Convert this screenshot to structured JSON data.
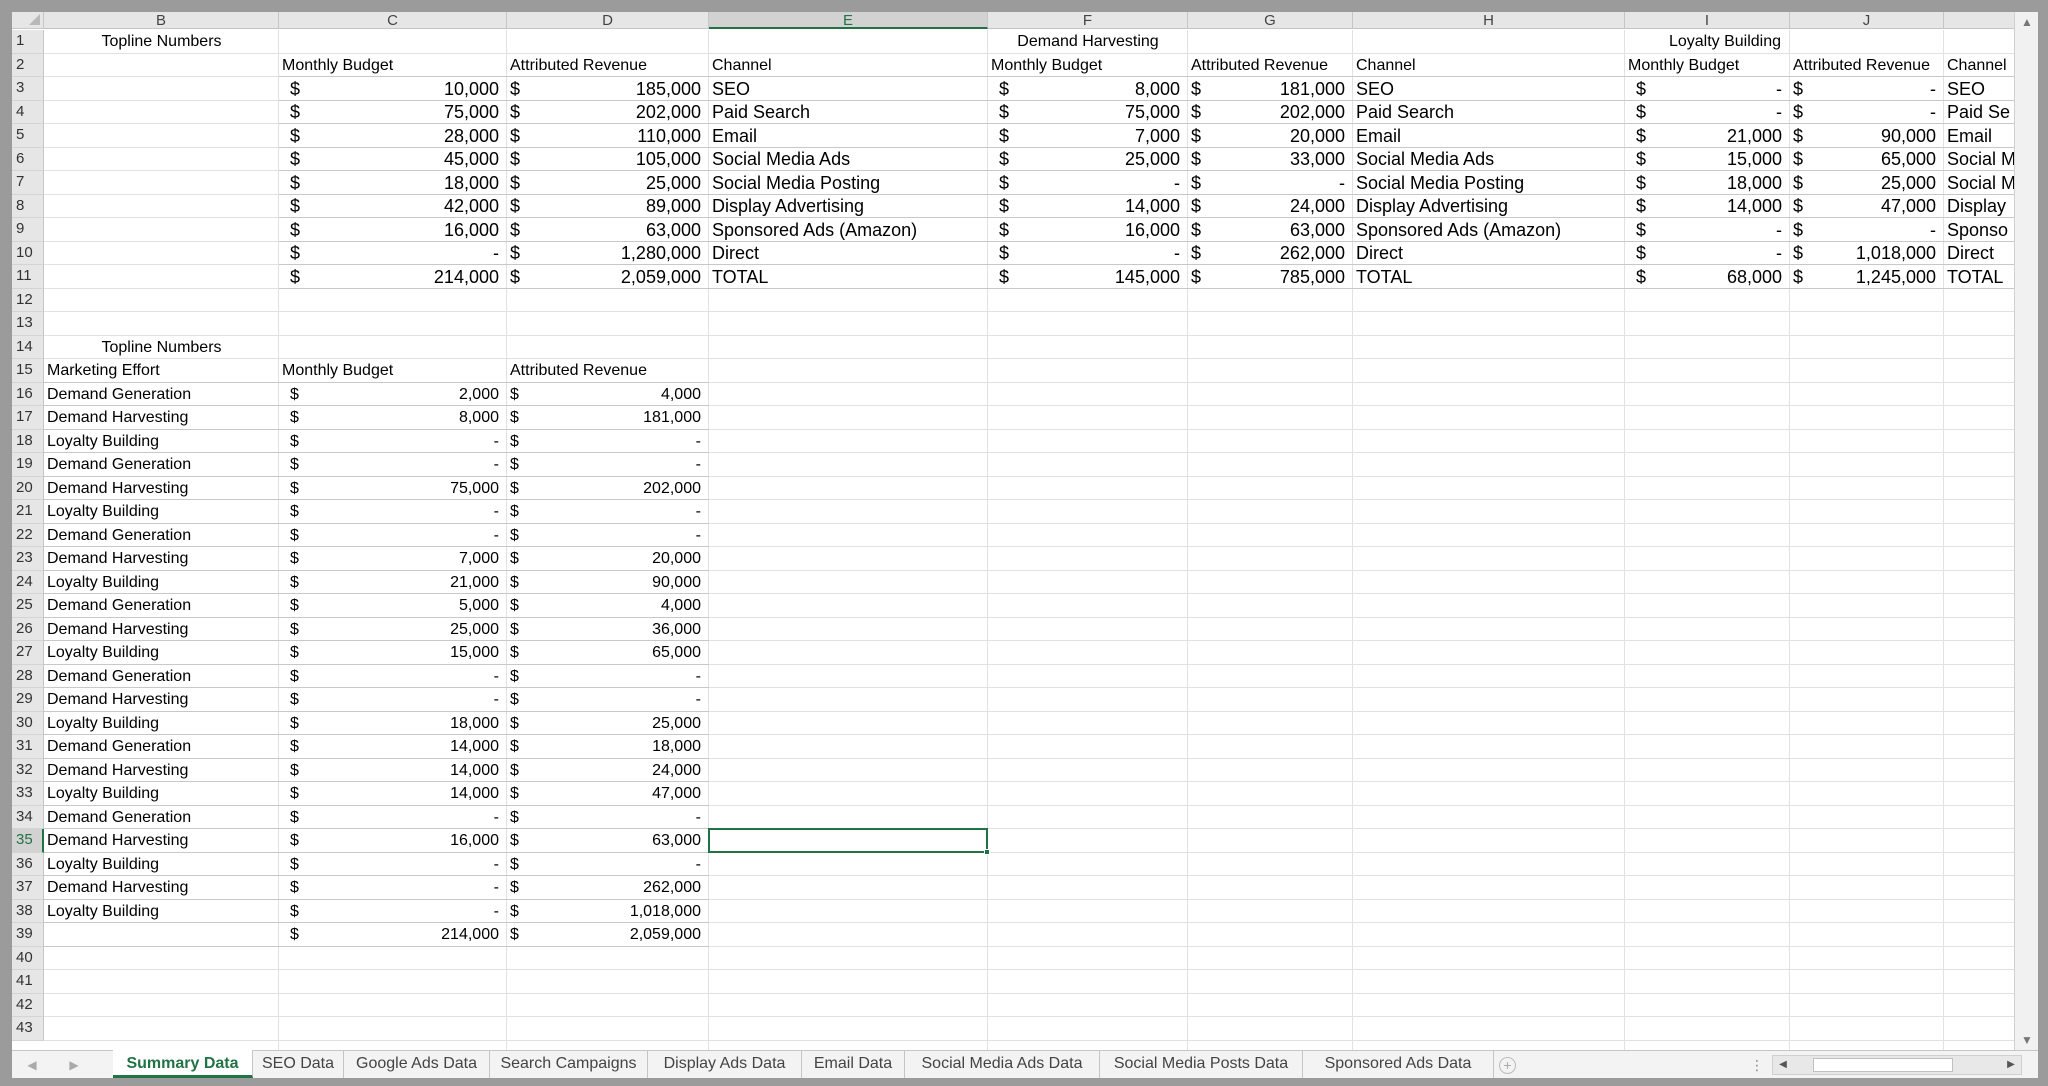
{
  "columns": [
    "B",
    "C",
    "D",
    "E",
    "F",
    "G",
    "H",
    "I",
    "J"
  ],
  "rows": [
    "1",
    "2",
    "3",
    "4",
    "5",
    "6",
    "7",
    "8",
    "9",
    "10",
    "11",
    "12",
    "13",
    "14",
    "15",
    "16",
    "17",
    "18",
    "19",
    "20",
    "21",
    "22",
    "23",
    "24",
    "25",
    "26",
    "27",
    "28",
    "29",
    "30",
    "31",
    "32",
    "33",
    "34",
    "35",
    "36",
    "37",
    "38",
    "39",
    "40",
    "41",
    "42",
    "43"
  ],
  "selected": {
    "column": "E",
    "row": "35"
  },
  "top_section": {
    "titles": [
      "Topline Numbers",
      "Demand Harvesting",
      "Loyalty Building"
    ],
    "headers": [
      "Monthly Budget",
      "Attributed Revenue",
      "Channel",
      "Monthly Budget",
      "Attributed Revenue",
      "Channel",
      "Monthly Budget",
      "Attributed Revenue",
      "Channel"
    ],
    "rows": [
      [
        "$",
        "10,000",
        "$",
        "185,000",
        "SEO",
        "$",
        "8,000",
        "$",
        "181,000",
        "SEO",
        "$",
        "-",
        "$",
        "-",
        "SEO"
      ],
      [
        "$",
        "75,000",
        "$",
        "202,000",
        "Paid Search",
        "$",
        "75,000",
        "$",
        "202,000",
        "Paid Search",
        "$",
        "-",
        "$",
        "-",
        "Paid Se"
      ],
      [
        "$",
        "28,000",
        "$",
        "110,000",
        "Email",
        "$",
        "7,000",
        "$",
        "20,000",
        "Email",
        "$",
        "21,000",
        "$",
        "90,000",
        "Email"
      ],
      [
        "$",
        "45,000",
        "$",
        "105,000",
        "Social Media Ads",
        "$",
        "25,000",
        "$",
        "33,000",
        "Social Media Ads",
        "$",
        "15,000",
        "$",
        "65,000",
        "Social M"
      ],
      [
        "$",
        "18,000",
        "$",
        "25,000",
        "Social Media Posting",
        "$",
        "-",
        "$",
        "-",
        "Social Media Posting",
        "$",
        "18,000",
        "$",
        "25,000",
        "Social M"
      ],
      [
        "$",
        "42,000",
        "$",
        "89,000",
        "Display Advertising",
        "$",
        "14,000",
        "$",
        "24,000",
        "Display Advertising",
        "$",
        "14,000",
        "$",
        "47,000",
        "Display"
      ],
      [
        "$",
        "16,000",
        "$",
        "63,000",
        "Sponsored Ads (Amazon)",
        "$",
        "16,000",
        "$",
        "63,000",
        "Sponsored Ads (Amazon)",
        "$",
        "-",
        "$",
        "-",
        "Sponso"
      ],
      [
        "$",
        "-",
        "$",
        "1,280,000",
        "Direct",
        "$",
        "-",
        "$",
        "262,000",
        "Direct",
        "$",
        "-",
        "$",
        "1,018,000",
        "Direct"
      ],
      [
        "$",
        "214,000",
        "$",
        "2,059,000",
        "TOTAL",
        "$",
        "145,000",
        "$",
        "785,000",
        "TOTAL",
        "$",
        "68,000",
        "$",
        "1,245,000",
        "TOTAL"
      ]
    ]
  },
  "bottom_section": {
    "title": "Topline Numbers",
    "headers": [
      "Marketing Effort",
      "Monthly Budget",
      "Attributed Revenue"
    ],
    "rows": [
      [
        "Demand Generation",
        "$",
        "2,000",
        "$",
        "4,000"
      ],
      [
        "Demand Harvesting",
        "$",
        "8,000",
        "$",
        "181,000"
      ],
      [
        "Loyalty Building",
        "$",
        "-",
        "$",
        "-"
      ],
      [
        "Demand Generation",
        "$",
        "-",
        "$",
        "-"
      ],
      [
        "Demand Harvesting",
        "$",
        "75,000",
        "$",
        "202,000"
      ],
      [
        "Loyalty Building",
        "$",
        "-",
        "$",
        "-"
      ],
      [
        "Demand Generation",
        "$",
        "-",
        "$",
        "-"
      ],
      [
        "Demand Harvesting",
        "$",
        "7,000",
        "$",
        "20,000"
      ],
      [
        "Loyalty Building",
        "$",
        "21,000",
        "$",
        "90,000"
      ],
      [
        "Demand Generation",
        "$",
        "5,000",
        "$",
        "4,000"
      ],
      [
        "Demand Harvesting",
        "$",
        "25,000",
        "$",
        "36,000"
      ],
      [
        "Loyalty Building",
        "$",
        "15,000",
        "$",
        "65,000"
      ],
      [
        "Demand Generation",
        "$",
        "-",
        "$",
        "-"
      ],
      [
        "Demand Harvesting",
        "$",
        "-",
        "$",
        "-"
      ],
      [
        "Loyalty Building",
        "$",
        "18,000",
        "$",
        "25,000"
      ],
      [
        "Demand Generation",
        "$",
        "14,000",
        "$",
        "18,000"
      ],
      [
        "Demand Harvesting",
        "$",
        "14,000",
        "$",
        "24,000"
      ],
      [
        "Loyalty Building",
        "$",
        "14,000",
        "$",
        "47,000"
      ],
      [
        "Demand Generation",
        "$",
        "-",
        "$",
        "-"
      ],
      [
        "Demand Harvesting",
        "$",
        "16,000",
        "$",
        "63,000"
      ],
      [
        "Loyalty Building",
        "$",
        "-",
        "$",
        "-"
      ],
      [
        "Demand Harvesting",
        "$",
        "-",
        "$",
        "262,000"
      ],
      [
        "Loyalty Building",
        "$",
        "-",
        "$",
        "1,018,000"
      ],
      [
        "",
        "$",
        "214,000",
        "$",
        "2,059,000"
      ]
    ]
  },
  "sheet_tabs": [
    {
      "label": "Summary Data",
      "active": true
    },
    {
      "label": "SEO Data",
      "active": false
    },
    {
      "label": "Google Ads Data",
      "active": false
    },
    {
      "label": "Search Campaigns",
      "active": false
    },
    {
      "label": "Display Ads Data",
      "active": false
    },
    {
      "label": "Email Data",
      "active": false
    },
    {
      "label": "Social Media Ads Data",
      "active": false
    },
    {
      "label": "Social Media Posts Data",
      "active": false
    },
    {
      "label": "Sponsored Ads Data",
      "active": false
    }
  ],
  "icons": {
    "add_sheet": "plus-circle-icon",
    "scroll_left": "triangle-left-icon",
    "scroll_right": "triangle-right-icon",
    "scroll_up": "triangle-up-icon",
    "scroll_down": "triangle-down-icon",
    "more": "ellipsis-icon"
  },
  "colors": {
    "accent": "#217346",
    "header_bg": "#e6e6e6",
    "frame": "#9b9b9b"
  }
}
